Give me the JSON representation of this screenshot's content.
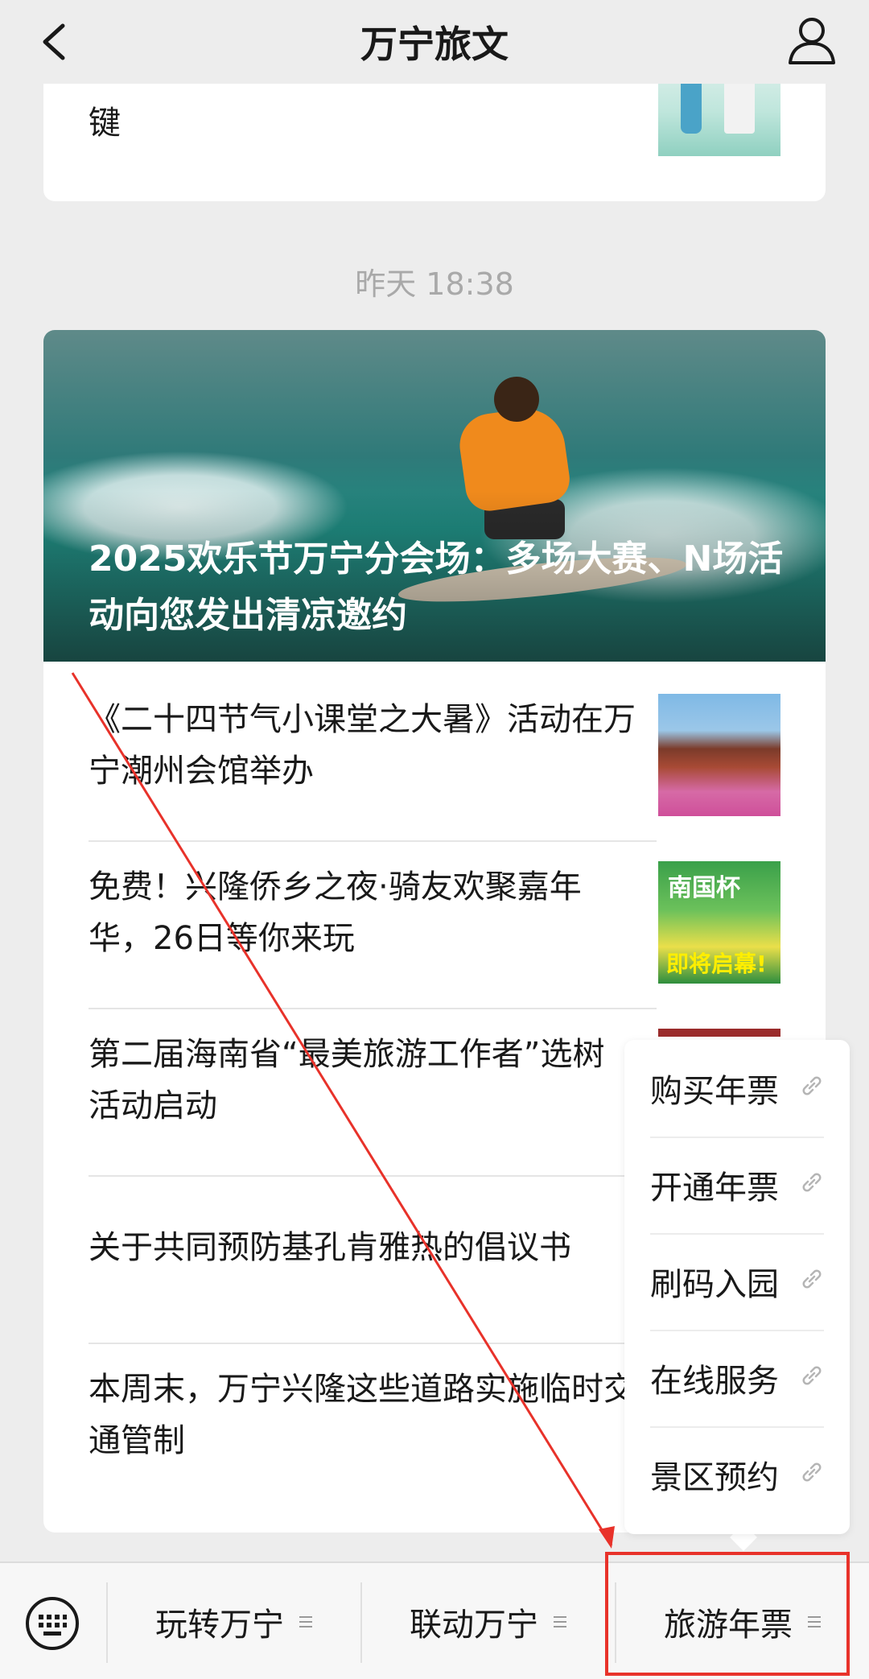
{
  "header": {
    "title": "万宁旅文"
  },
  "prev_article": {
    "text": "键"
  },
  "timestamp": "昨天 18:38",
  "hero": {
    "title": "2025欢乐节万宁分会场：多场大赛、N场活动向您发出清凉邀约"
  },
  "articles": [
    {
      "title": "《二十四节气小课堂之大暑》活动在万宁潮州会馆举办"
    },
    {
      "title": "免费！兴隆侨乡之夜·骑友欢聚嘉年华，26日等你来玩",
      "thumb_text": "南国杯",
      "thumb_text2": "即将启幕!"
    },
    {
      "title": "第二届海南省“最美旅游工作者”选树活动启动"
    },
    {
      "title": "关于共同预防基孔肯雅热的倡议书"
    },
    {
      "title": "本周末，万宁兴隆这些道路实施临时交通管制"
    }
  ],
  "popup_menu": {
    "items": [
      {
        "label": "购买年票",
        "icon": "link-icon"
      },
      {
        "label": "开通年票",
        "icon": "link-icon"
      },
      {
        "label": "刷码入园",
        "icon": "link-icon"
      },
      {
        "label": "在线服务",
        "icon": "link-icon"
      },
      {
        "label": "景区预约",
        "icon": "link-icon"
      }
    ]
  },
  "bottom_menu": {
    "keyboard_icon": "keyboard-icon",
    "items": [
      {
        "label": "玩转万宁",
        "icon": "menu-lines-icon"
      },
      {
        "label": "联动万宁",
        "icon": "menu-lines-icon"
      },
      {
        "label": "旅游年票",
        "icon": "menu-lines-icon"
      }
    ]
  },
  "annotation": {
    "color": "#e8322a"
  }
}
